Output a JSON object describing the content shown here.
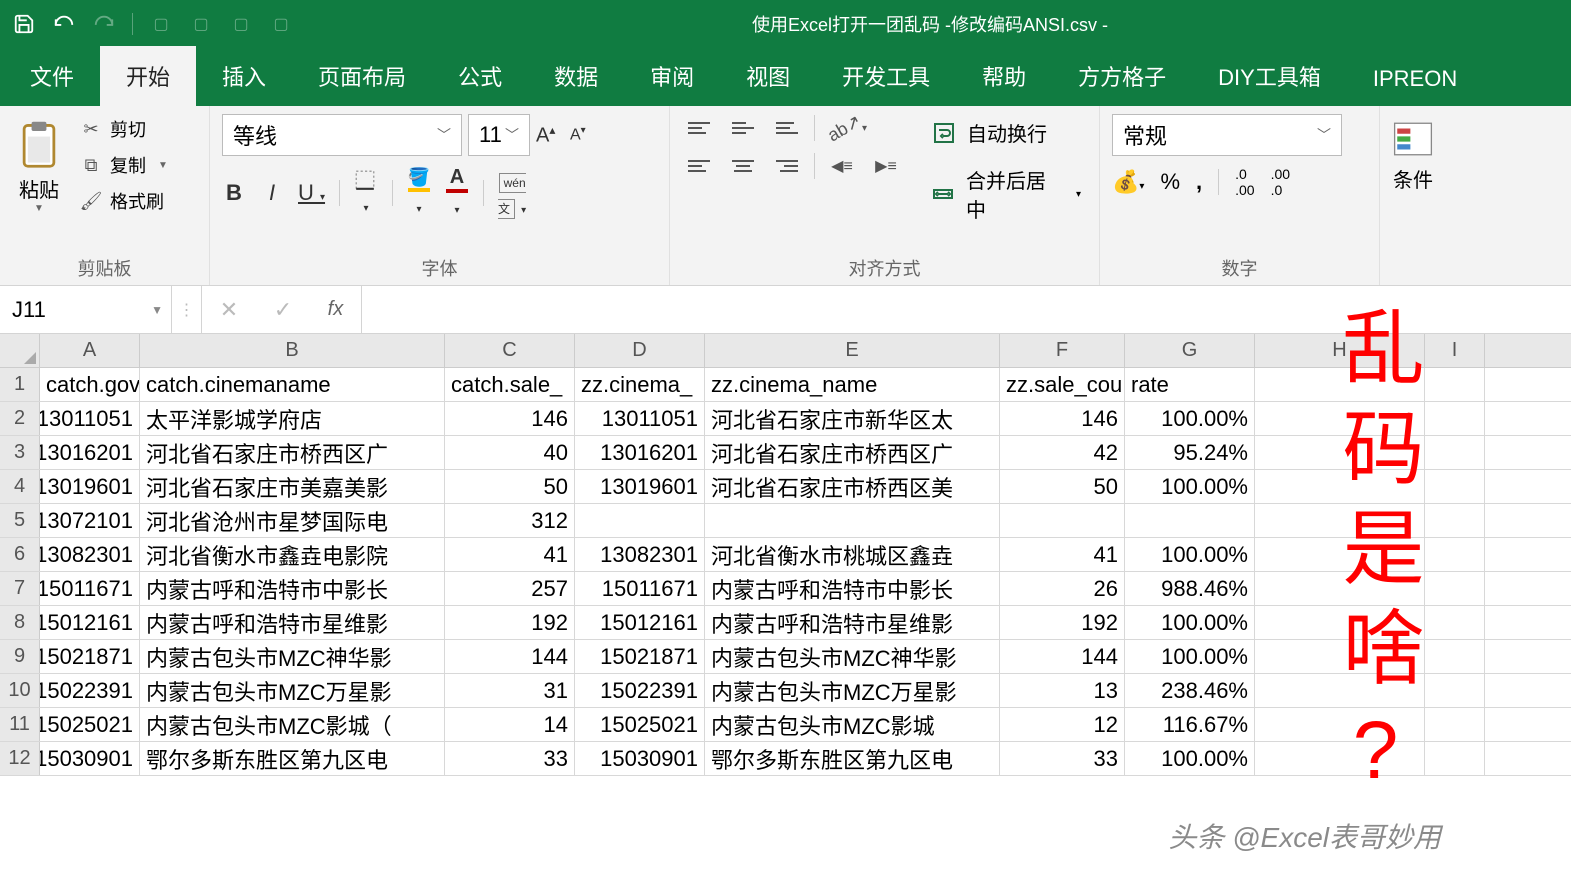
{
  "titlebar": {
    "title": "使用Excel打开一团乱码 -修改编码ANSI.csv -"
  },
  "tabs": {
    "file": "文件",
    "home": "开始",
    "insert": "插入",
    "pageLayout": "页面布局",
    "formulas": "公式",
    "data": "数据",
    "review": "审阅",
    "view": "视图",
    "developer": "开发工具",
    "help": "帮助",
    "fangfang": "方方格子",
    "diy": "DIY工具箱",
    "ipreon": "IPREON"
  },
  "ribbon": {
    "clipboard": {
      "paste": "粘贴",
      "cut": "剪切",
      "copy": "复制",
      "formatPainter": "格式刷",
      "group": "剪贴板"
    },
    "font": {
      "name": "等线",
      "size": "11",
      "group": "字体"
    },
    "alignment": {
      "wrap": "自动换行",
      "merge": "合并后居中",
      "group": "对齐方式"
    },
    "number": {
      "format": "常规",
      "group": "数字"
    },
    "conditional": {
      "label": "条件"
    }
  },
  "formulaBar": {
    "nameBox": "J11",
    "formula": ""
  },
  "grid": {
    "columns": [
      "A",
      "B",
      "C",
      "D",
      "E",
      "F",
      "G",
      "H",
      "I"
    ],
    "header": {
      "A": "catch.govc",
      "B": "catch.cinemaname",
      "C": "catch.sale_",
      "D": "zz.cinema_",
      "E": "zz.cinema_name",
      "F": "zz.sale_cou",
      "G": "rate"
    },
    "rows": [
      {
        "A": "13011051",
        "B": "太平洋影城学府店",
        "C": "146",
        "D": "13011051",
        "E": "河北省石家庄市新华区太",
        "F": "146",
        "G": "100.00%"
      },
      {
        "A": "13016201",
        "B": "河北省石家庄市桥西区广",
        "C": "40",
        "D": "13016201",
        "E": "河北省石家庄市桥西区广",
        "F": "42",
        "G": "95.24%"
      },
      {
        "A": "13019601",
        "B": "河北省石家庄市美嘉美影",
        "C": "50",
        "D": "13019601",
        "E": "河北省石家庄市桥西区美",
        "F": "50",
        "G": "100.00%"
      },
      {
        "A": "13072101",
        "B": "河北省沧州市星梦国际电",
        "C": "312",
        "D": "",
        "E": "",
        "F": "",
        "G": ""
      },
      {
        "A": "13082301",
        "B": "河北省衡水市鑫垚电影院",
        "C": "41",
        "D": "13082301",
        "E": "河北省衡水市桃城区鑫垚",
        "F": "41",
        "G": "100.00%"
      },
      {
        "A": "15011671",
        "B": "内蒙古呼和浩特市中影长",
        "C": "257",
        "D": "15011671",
        "E": "内蒙古呼和浩特市中影长",
        "F": "26",
        "G": "988.46%"
      },
      {
        "A": "15012161",
        "B": "内蒙古呼和浩特市星维影",
        "C": "192",
        "D": "15012161",
        "E": "内蒙古呼和浩特市星维影",
        "F": "192",
        "G": "100.00%"
      },
      {
        "A": "15021871",
        "B": "内蒙古包头市MZC神华影",
        "C": "144",
        "D": "15021871",
        "E": "内蒙古包头市MZC神华影",
        "F": "144",
        "G": "100.00%"
      },
      {
        "A": "15022391",
        "B": "内蒙古包头市MZC万星影",
        "C": "31",
        "D": "15022391",
        "E": "内蒙古包头市MZC万星影",
        "F": "13",
        "G": "238.46%"
      },
      {
        "A": "15025021",
        "B": "内蒙古包头市MZC影城（",
        "C": "14",
        "D": "15025021",
        "E": "内蒙古包头市MZC影城",
        "F": "12",
        "G": "116.67%"
      },
      {
        "A": "15030901",
        "B": "鄂尔多斯东胜区第九区电",
        "C": "33",
        "D": "15030901",
        "E": "鄂尔多斯东胜区第九区电",
        "F": "33",
        "G": "100.00%"
      }
    ]
  },
  "overlay": {
    "text": "乱码是啥?",
    "watermark": "头条 @Excel表哥妙用"
  }
}
